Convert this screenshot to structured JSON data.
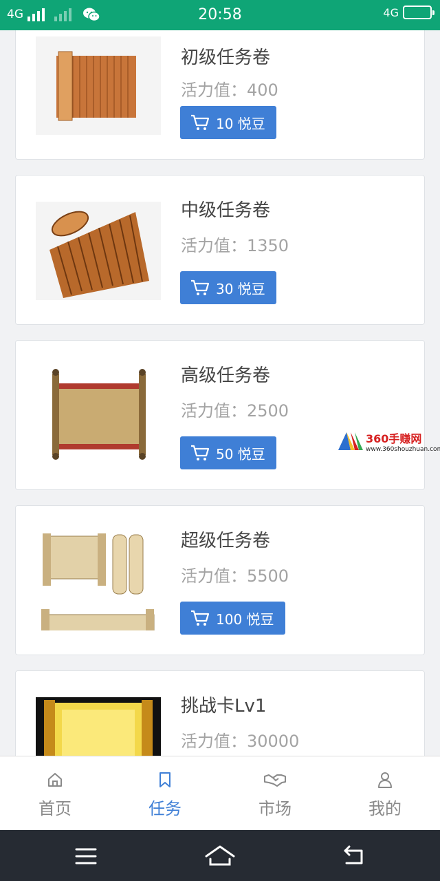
{
  "status_bar": {
    "network_left": "4G",
    "time": "20:58",
    "network_right": "4G"
  },
  "items": [
    {
      "title": "初级任务卷",
      "energy_label": "活力值：400",
      "price": "10 悦豆",
      "image": "bamboo-scroll-open"
    },
    {
      "title": "中级任务卷",
      "energy_label": "活力值：1350",
      "price": "30 悦豆",
      "image": "bamboo-scroll-rolled"
    },
    {
      "title": "高级任务卷",
      "energy_label": "活力值：2500",
      "price": "50 悦豆",
      "image": "parchment-scroll"
    },
    {
      "title": "超级任务卷",
      "energy_label": "活力值：5500",
      "price": "100 悦豆",
      "image": "torah-scrolls"
    },
    {
      "title": "挑战卡Lv1",
      "energy_label": "活力值：30000",
      "price": "",
      "image": "golden-scroll"
    }
  ],
  "watermark": {
    "brand": "360手赚网",
    "url": "www.360shouzhuan.com"
  },
  "tabs": [
    {
      "label": "首页",
      "icon": "home-icon",
      "active": false
    },
    {
      "label": "任务",
      "icon": "bookmark-icon",
      "active": true
    },
    {
      "label": "市场",
      "icon": "handshake-icon",
      "active": false
    },
    {
      "label": "我的",
      "icon": "user-icon",
      "active": false
    }
  ],
  "colors": {
    "status_bar": "#0fa576",
    "button": "#3f7fd6",
    "active_tab": "#3f7fd6",
    "nav_bar": "#262b33"
  }
}
